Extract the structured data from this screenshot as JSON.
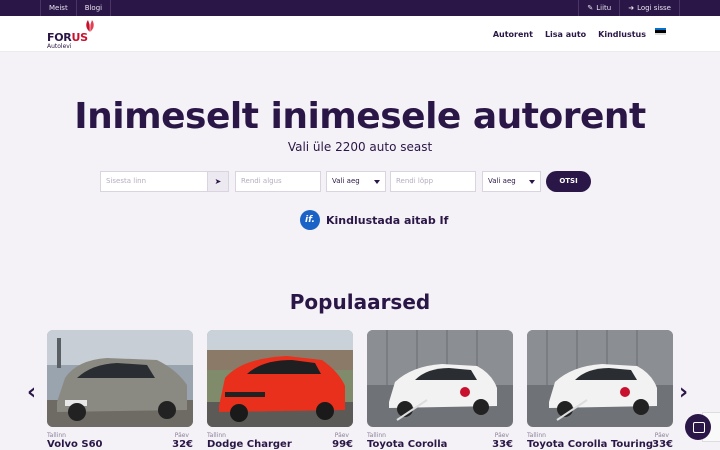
{
  "topbar": {
    "left": [
      "Meist",
      "Blogi"
    ],
    "right": [
      {
        "icon": "edit-icon",
        "label": "Liitu"
      },
      {
        "icon": "sign-in-icon",
        "label": "Logi sisse"
      }
    ]
  },
  "logo": {
    "text_a": "FOR",
    "text_b": "US",
    "sub": "Autolevi"
  },
  "nav": [
    "Autorent",
    "Lisa auto",
    "Kindlustus"
  ],
  "language_flag": {
    "colors": [
      "#0072ce",
      "#000000",
      "#ffffff"
    ]
  },
  "hero": {
    "title": "Inimeselt inimesele autorent",
    "subtitle": "Vali üle 2200 auto seast"
  },
  "search": {
    "city_placeholder": "Sisesta linn",
    "start_placeholder": "Rendi algus",
    "start_time": "Vali aeg",
    "end_placeholder": "Rendi lõpp",
    "end_time": "Vali aeg",
    "submit": "OTSI"
  },
  "insurance": {
    "logo": "if.",
    "text": "Kindlustada aitab If"
  },
  "popular": {
    "title": "Populaarsed",
    "cards": [
      {
        "city": "Tallinn",
        "per": "Päev",
        "name": "Volvo S60",
        "price": "32€",
        "color": "#8a8a82"
      },
      {
        "city": "Tallinn",
        "per": "Päev",
        "name": "Dodge Charger",
        "price": "99€",
        "color": "#e8301c"
      },
      {
        "city": "Tallinn",
        "per": "Päev",
        "name": "Toyota Corolla",
        "price": "33€",
        "color": "#f2f2f2"
      },
      {
        "city": "Tallinn",
        "per": "Päev",
        "name": "Toyota Corolla Touring",
        "price": "33€",
        "color": "#f2f2f2"
      }
    ]
  },
  "colors": {
    "brand": "#2b1747",
    "accent": "#c8102e",
    "if_blue": "#1b62c7"
  }
}
